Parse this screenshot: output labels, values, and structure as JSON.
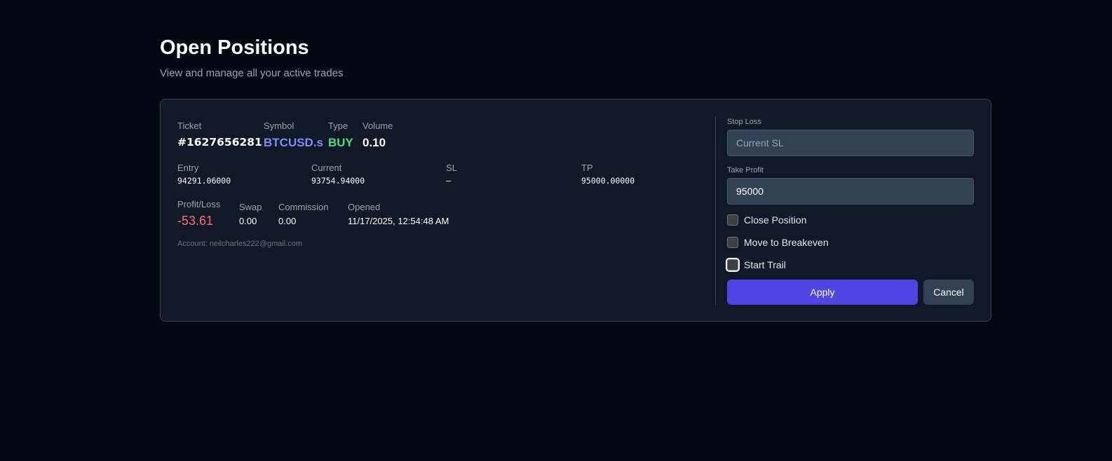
{
  "header": {
    "title": "Open Positions",
    "subtitle": "View and manage all your active trades"
  },
  "position": {
    "ticket_label": "Ticket",
    "ticket": "#1627656281",
    "symbol_label": "Symbol",
    "symbol": "BTCUSD.s",
    "type_label": "Type",
    "type": "BUY",
    "volume_label": "Volume",
    "volume": "0.10",
    "entry_label": "Entry",
    "entry": "94291.06000",
    "current_label": "Current",
    "current": "93754.94000",
    "sl_label": "SL",
    "sl": "–",
    "tp_label": "TP",
    "tp": "95000.00000",
    "pl_label": "Profit/Loss",
    "pl": "-53.61",
    "swap_label": "Swap",
    "swap": "0.00",
    "commission_label": "Commission",
    "commission": "0.00",
    "opened_label": "Opened",
    "opened": "11/17/2025, 12:54:48 AM",
    "account": "Account: neilcharles222@gmail.com"
  },
  "form": {
    "sl_label": "Stop Loss",
    "sl_value": "",
    "sl_placeholder": "Current SL",
    "tp_label": "Take Profit",
    "tp_value": "95000",
    "close_position": "Close Position",
    "breakeven": "Move to Breakeven",
    "trail": "Start Trail",
    "apply": "Apply",
    "cancel": "Cancel"
  },
  "colors": {
    "symbol": "#818cf8",
    "buy": "#4ade80",
    "loss": "#f87171",
    "accent": "#4f46e5"
  }
}
